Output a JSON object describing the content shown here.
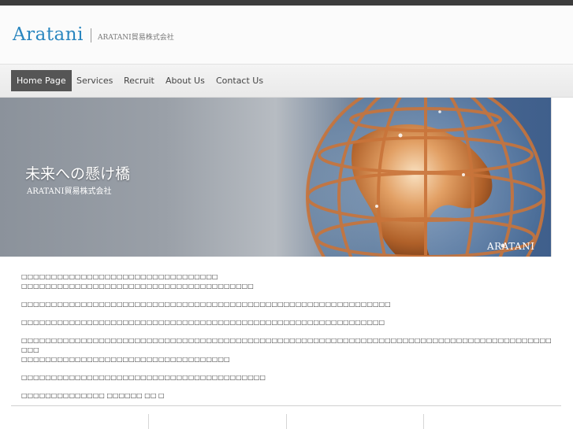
{
  "header": {
    "logo": "Aratani",
    "logo_sub": "ARATANI貿易株式会社"
  },
  "nav": {
    "items": [
      "Home Page",
      "Services",
      "Recruit",
      "About Us",
      "Contact Us"
    ],
    "active_index": 0
  },
  "hero": {
    "title": "未来への懸け橋",
    "subtitle": "ARATANI貿易株式会社",
    "brand": "ARATANI"
  },
  "content": {
    "paragraphs": [
      "□□□□□□□□□□□□□□□□□□□□□□□□□□□□□□□□□\n□□□□□□□□□□□□□□□□□□□□□□□□□□□□□□□□□□□□□□□",
      "□□□□□□□□□□□□□□□□□□□□□□□□□□□□□□□□□□□□□□□□□□□□□□□□□□□□□□□□□□□□□□",
      "□□□□□□□□□□□□□□□□□□□□□□□□□□□□□□□□□□□□□□□□□□□□□□□□□□□□□□□□□□□□□",
      "□□□□□□□□□□□□□□□□□□□□□□□□□□□□□□□□□□□□□□□□□□□□□□□□□□□□□□□□□□□□□□□□□□□□□□□□□□□□□□□□□□□□□□□□□□□□\n□□□□□□□□□□□□□□□□□□□□□□□□□□□□□□□□□□□",
      "□□□□□□□□□□□□□□□□□□□□□□□□□□□□□□□□□□□□□□□□□",
      "□□□□□□□□□□□□□□ □□□□□□ □□ □"
    ]
  },
  "colors": {
    "topbar": "#3c3c3c",
    "logo": "#2a86bf",
    "nav_active_bg": "#555555"
  }
}
